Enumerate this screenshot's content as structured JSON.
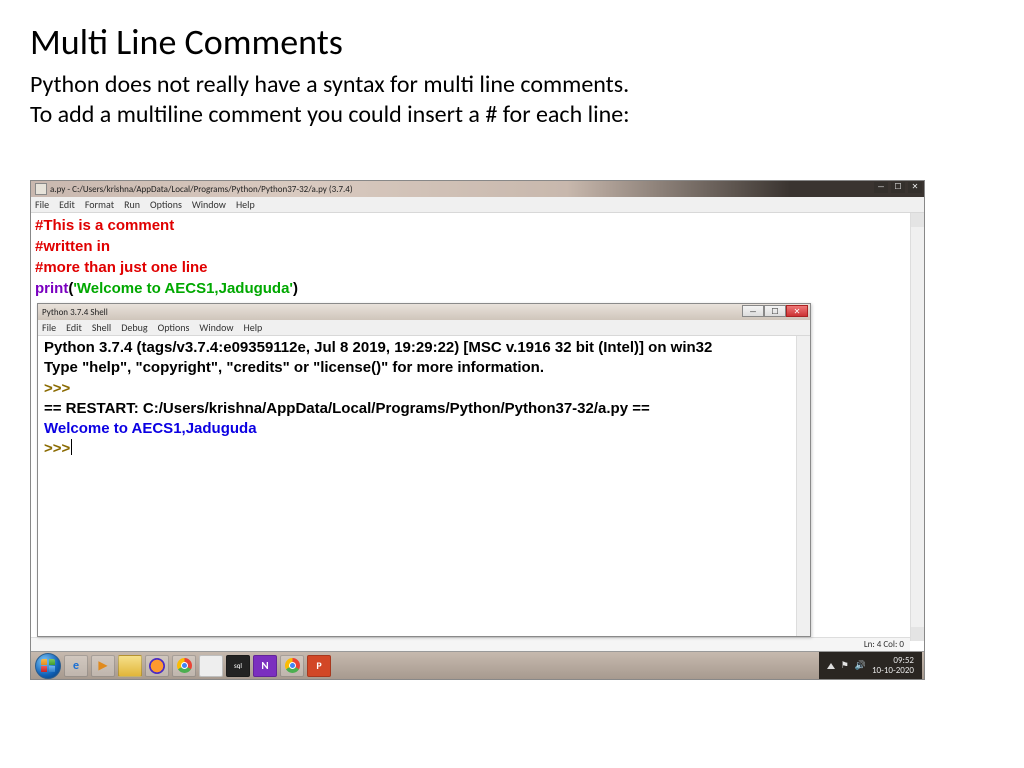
{
  "slide": {
    "title": "Multi Line Comments",
    "line1": "Python does not really have a syntax for multi line comments.",
    "line2": "To add a multiline comment you could insert a # for each line:"
  },
  "editor": {
    "titlebar": "a.py - C:/Users/krishna/AppData/Local/Programs/Python/Python37-32/a.py (3.7.4)",
    "menu": [
      "File",
      "Edit",
      "Format",
      "Run",
      "Options",
      "Window",
      "Help"
    ],
    "code": {
      "c1": "#This is a comment",
      "c2": "#written in",
      "c3": "#more than just one line",
      "print_kw": "print",
      "lparen": "(",
      "string": "'Welcome to AECS1,Jaduguda'",
      "rparen": ")"
    },
    "status": "Ln: 4   Col: 0"
  },
  "shell": {
    "titlebar": "Python 3.7.4 Shell",
    "menu": [
      "File",
      "Edit",
      "Shell",
      "Debug",
      "Options",
      "Window",
      "Help"
    ],
    "banner1": "Python 3.7.4 (tags/v3.7.4:e09359112e, Jul  8 2019, 19:29:22) [MSC v.1916 32 bit (Intel)] on win32",
    "banner2": "Type \"help\", \"copyright\", \"credits\" or \"license()\" for more information.",
    "prompt1": ">>>",
    "restart": "== RESTART: C:/Users/krishna/AppData/Local/Programs/Python/Python37-32/a.py ==",
    "output": "Welcome to AECS1,Jaduguda",
    "prompt2": ">>>"
  },
  "win_controls": {
    "min": "—",
    "max": "☐",
    "close": "✕"
  },
  "taskbar": {
    "icons": {
      "ie": "e",
      "wmp": "▶",
      "n": "N",
      "ppt": "P",
      "mysql": "sql"
    },
    "tray": {
      "time": "09:52",
      "date": "10-10-2020"
    }
  }
}
